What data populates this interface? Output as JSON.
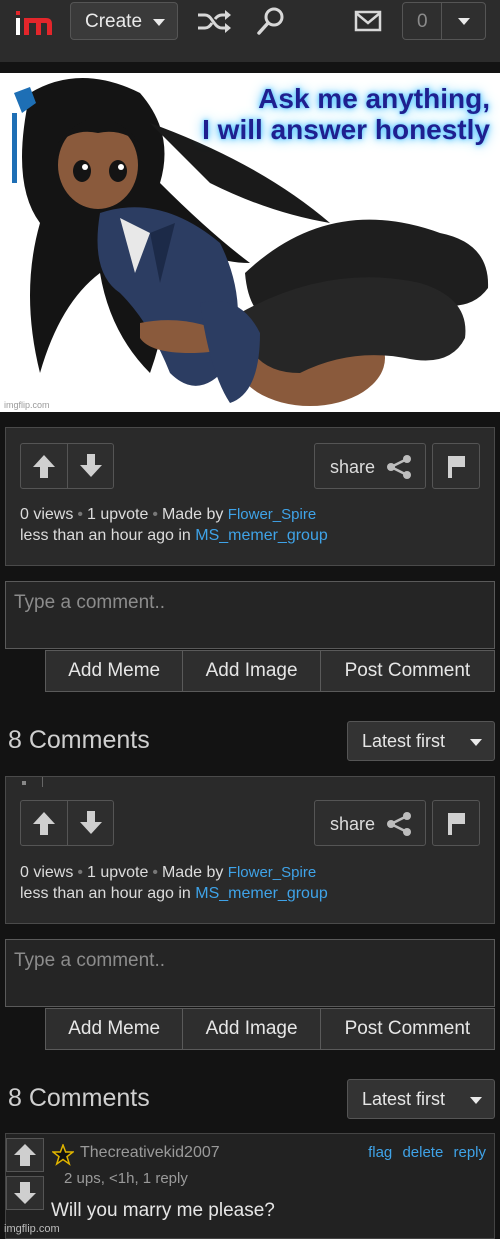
{
  "header": {
    "logo_text": "im",
    "create_label": "Create",
    "notification_count": "0",
    "icons": [
      "shuffle-icon",
      "search-icon",
      "mail-icon",
      "chevron-down-icon"
    ]
  },
  "hero": {
    "caption_line1": "Ask me anything,",
    "caption_line2": "I will answer honestly",
    "watermark": "imgflip.com"
  },
  "post_panels": [
    {
      "share_label": "share",
      "views": "0 views",
      "upvotes": "1 upvote",
      "made_by": "Made by",
      "author": "Flower_Spire",
      "time_text": "less than an hour ago in",
      "group": "MS_memer_group"
    },
    {
      "share_label": "share",
      "views": "0 views",
      "upvotes": "1 upvote",
      "made_by": "Made by",
      "author": "Flower_Spire",
      "time_text": "less than an hour ago in",
      "group": "MS_memer_group"
    }
  ],
  "comment_form": {
    "placeholder": "Type a comment..",
    "add_meme": "Add Meme",
    "add_image": "Add Image",
    "post_comment": "Post Comment"
  },
  "comments_header": {
    "title": "8 Comments",
    "sort": "Latest first"
  },
  "comment": {
    "username": "Thecreativekid2007",
    "flag": "flag",
    "delete": "delete",
    "reply": "reply",
    "stats": "2 ups, <1h, 1 reply",
    "text": "Will you marry me please?"
  },
  "footer_watermark": "imgflip.com",
  "colors": {
    "link": "#3fa3e8",
    "logo_red": "#e3262b",
    "background": "#131313"
  }
}
